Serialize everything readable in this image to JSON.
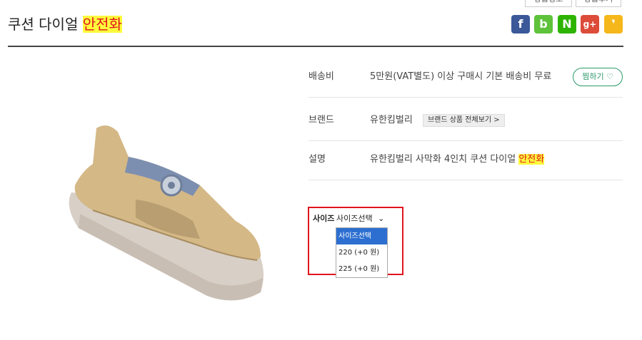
{
  "top_buttons": [
    "상품정보",
    "상품후기"
  ],
  "title": {
    "main": "쿠션 다이얼",
    "highlight": "안전화"
  },
  "share": [
    {
      "name": "facebook",
      "glyph": "f",
      "color": "#3b5998"
    },
    {
      "name": "band",
      "glyph": "b",
      "color": "#5ec23a"
    },
    {
      "name": "naver",
      "glyph": "N",
      "color": "#2db400"
    },
    {
      "name": "google-plus",
      "glyph": "g+",
      "color": "#dd4b39"
    },
    {
      "name": "kakaostory",
      "glyph": "❜",
      "color": "#f5b71a"
    }
  ],
  "info": {
    "shipping_label": "배송비",
    "shipping_value": "5만원(VAT별도) 이상 구매시 기본 배송비 무료",
    "wishlist_label": "찜하기 ♡",
    "brand_label": "브랜드",
    "brand_value": "유한킴벌리",
    "brand_link": "브랜드 상품 전체보기 >",
    "desc_label": "설명",
    "desc_value": "유한킴벌리 사막화 4인치 쿠션 다이얼",
    "desc_highlight": "안전화"
  },
  "option": {
    "label": "사이즈",
    "selected": "사이즈선택",
    "items": [
      "사이즈선택",
      "220 (+0 원)",
      "225 (+0 원)"
    ]
  }
}
